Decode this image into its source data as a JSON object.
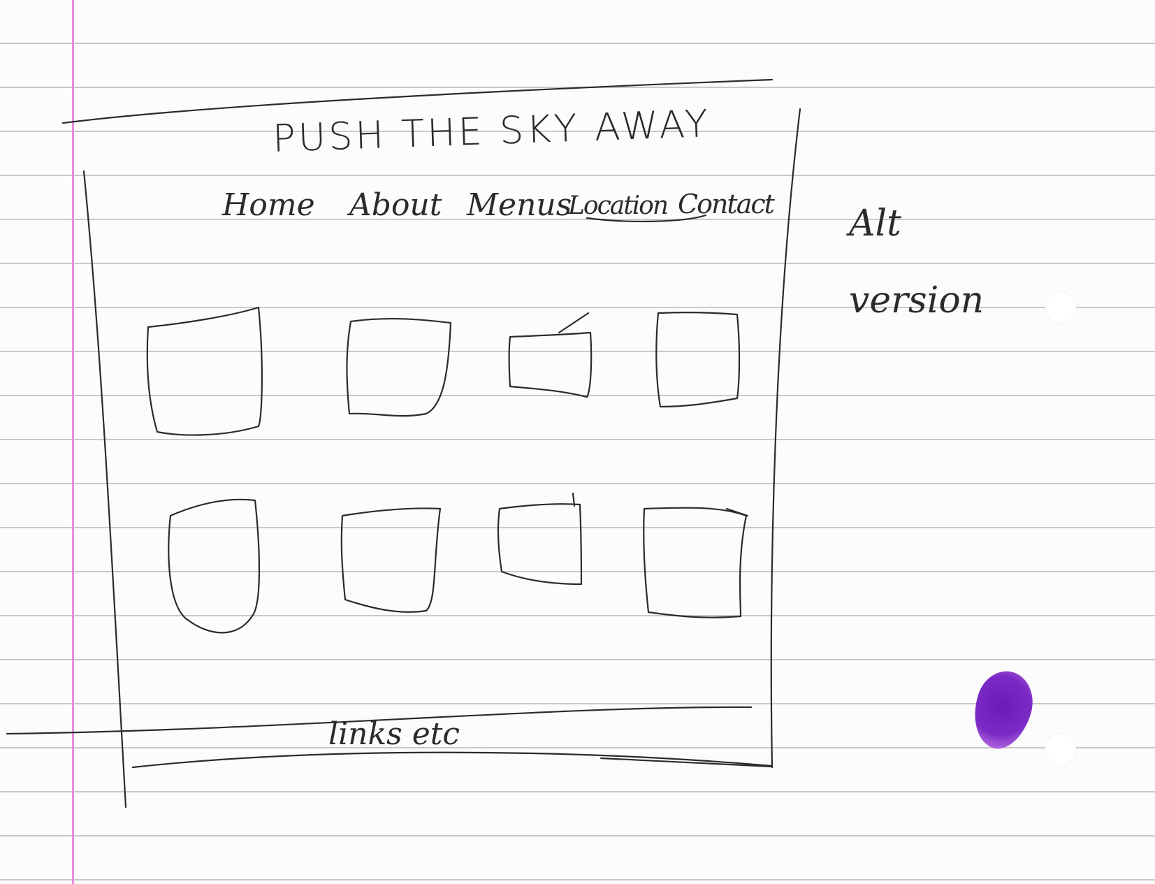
{
  "sketch": {
    "title": "PUSH THE SKY AWAY",
    "nav": {
      "home": "Home",
      "about": "About",
      "menus": "Menus",
      "location": "Location",
      "contact": "Contact"
    },
    "tiles_rows": 2,
    "tiles_per_row": 4,
    "footer": "links etc"
  },
  "note": {
    "line1": "Alt",
    "line2": "version"
  },
  "colors": {
    "ink": "#2b2b2b",
    "margin_line": "#e98be0",
    "ruled_line": "#c9c9c9",
    "ink_blot": "#6a1cb8"
  }
}
